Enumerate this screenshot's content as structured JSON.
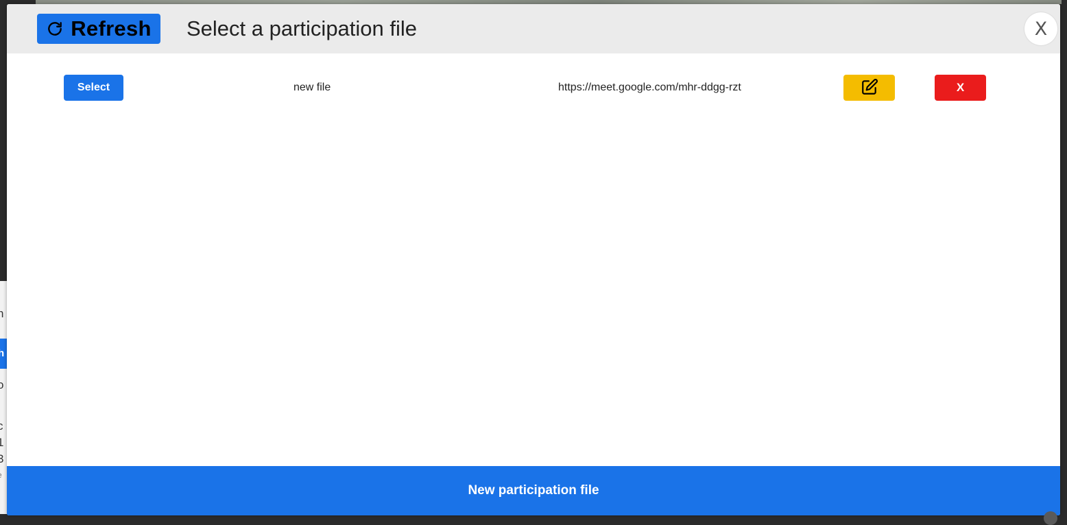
{
  "header": {
    "refresh_label": "Refresh",
    "refresh_icon": "refresh-icon",
    "title": "Select a participation file",
    "close_label": "X"
  },
  "files": [
    {
      "select_label": "Select",
      "name": "new file",
      "link": "https://meet.google.com/mhr-ddgg-rzt",
      "edit_icon": "edit-icon",
      "delete_label": "X"
    }
  ],
  "footer": {
    "new_file_label": "New participation file"
  },
  "colors": {
    "primary": "#1a73e8",
    "edit": "#f4bc00",
    "delete": "#ea1c1c",
    "header_bg": "#ebebeb"
  }
}
